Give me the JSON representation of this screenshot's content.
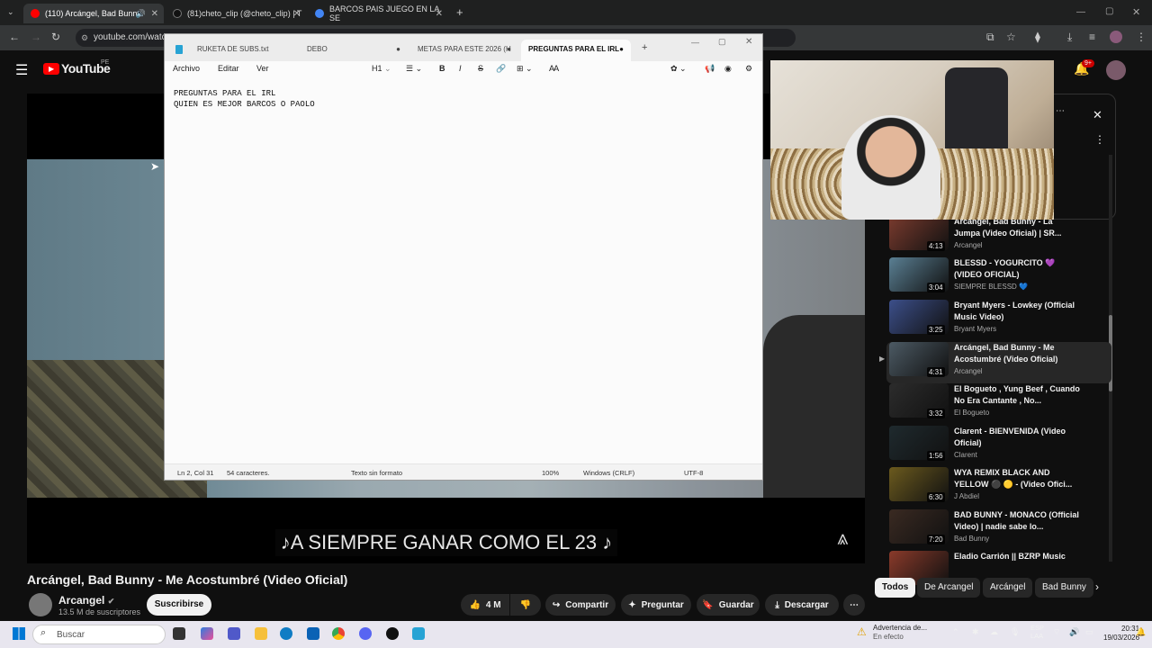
{
  "browser": {
    "tabs": [
      {
        "title": "(110) Arcángel, Bad Bunny",
        "favicon_color": "#ff0000"
      },
      {
        "title": "(81)cheto_clip (@cheto_clip) | T",
        "favicon_color": "#111111"
      },
      {
        "title": "BARCOS PAIS JUEGO EN LA SE",
        "favicon_color": "#4285f4"
      }
    ],
    "new_tab": "+",
    "url": "youtube.com/watc"
  },
  "youtube": {
    "logo": "YouTube",
    "region": "PE",
    "notifications": "9+",
    "video_title": "Arcángel, Bad Bunny - Me Acostumbré (Video Oficial)",
    "subtitle": "♪A SIEMPRE GANAR COMO EL 23 ♪",
    "channel": "Arcangel",
    "subscribers": "13.5 M de suscriptores",
    "subscribe": "Suscribirse",
    "likes": "4 M",
    "actions": {
      "share": "Compartir",
      "ask": "Preguntar",
      "save": "Guardar",
      "download": "Descargar"
    },
    "recommendations": [
      {
        "title": "Arcángel, Bad Bunny - La Jumpa (Video Oficial) | SR...",
        "channel": "Arcangel",
        "duration": "4:13",
        "color": "#7a3b2e"
      },
      {
        "title": "BLESSD - YOGURCITO 💜 (VIDEO OFICIAL)",
        "channel": "SIEMPRE BLESSD 💙",
        "duration": "3:04",
        "color": "#5a7f93"
      },
      {
        "title": "Bryant Myers - Lowkey (Official Music Video)",
        "channel": "Bryant Myers",
        "duration": "3:25",
        "color": "#3c4f8a"
      },
      {
        "title": "Arcángel, Bad Bunny - Me Acostumbré (Video Oficial)",
        "channel": "Arcangel",
        "duration": "4:31",
        "color": "#4c5a64"
      },
      {
        "title": "El Bogueto , Yung Beef , Cuando No Era Cantante , No...",
        "channel": "El Bogueto",
        "duration": "3:32",
        "color": "#2c2c2c"
      },
      {
        "title": "Clarent - BIENVENIDA (Video Oficial)",
        "channel": "Clarent",
        "duration": "1:56",
        "color": "#1f2a2e"
      },
      {
        "title": "WYA REMIX BLACK AND YELLOW ⚫ 🟡 - (Video Ofici...",
        "channel": "J Abdiel",
        "duration": "6:30",
        "color": "#6b5a1e"
      },
      {
        "title": "BAD BUNNY - MONACO (Official Video) | nadie sabe lo...",
        "channel": "Bad Bunny",
        "duration": "7:20",
        "color": "#3a2a22"
      },
      {
        "title": "Eladio Carrión || BZRP Music",
        "channel": "",
        "duration": "",
        "color": "#8a3a2a"
      }
    ],
    "chips": [
      "Todos",
      "De Arcangel",
      "Arcángel",
      "Bad Bunny"
    ]
  },
  "notepad": {
    "tabs": [
      "RUKETA DE SUBS.txt",
      "DEBO",
      "METAS PARA ESTE 2026 (H",
      "PREGUNTAS PARA EL IRL"
    ],
    "menu": [
      "Archivo",
      "Editar",
      "Ver"
    ],
    "heading": "H1",
    "content": "PREGUNTAS PARA EL IRL\nQUIEN ES MEJOR BARCOS O PAOLO",
    "status": {
      "position": "Ln 2, Col 31",
      "chars": "54 caracteres.",
      "format": "Texto sin formato",
      "zoom": "100%",
      "eol": "Windows (CRLF)",
      "encoding": "UTF-8"
    }
  },
  "taskbar": {
    "search": "Buscar",
    "warning_title": "Advertencia de...",
    "warning_sub": "En efecto",
    "lang": "ESP",
    "lang2": "LAA",
    "time": "20:31",
    "date": "19/03/2026"
  }
}
